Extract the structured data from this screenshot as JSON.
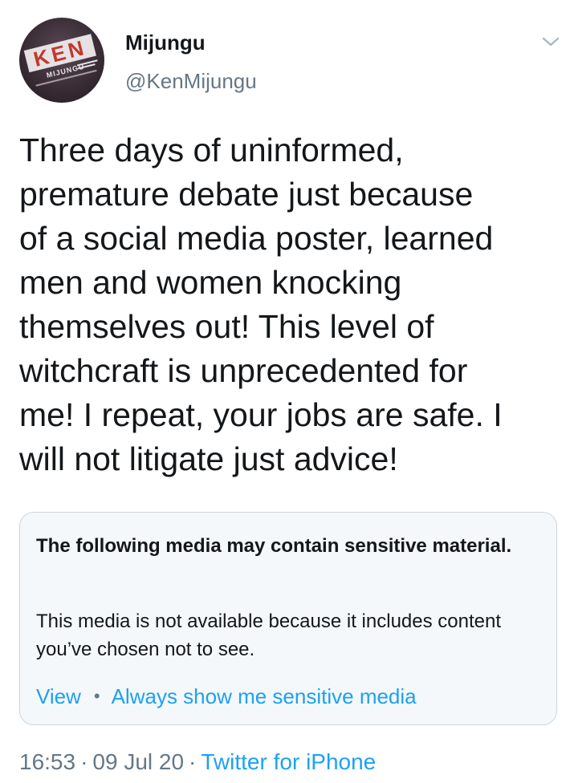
{
  "author": {
    "display_name": "Mijungu",
    "handle": "@KenMijungu",
    "avatar_logo_text": "KEN",
    "avatar_sub_text": "MIJUNGU"
  },
  "tweet": {
    "text_lines": [
      "Three days of uninformed,",
      "premature debate just because",
      "of a social media poster, learned",
      "men and women knocking",
      "themselves out! This level of",
      "witchcraft is unprecedented for",
      "me! I repeat, your jobs are safe. I",
      "will not litigate just advice!"
    ]
  },
  "sensitive_media": {
    "title": "The following media may contain sensitive material.",
    "body": "This media is not available because it includes content you’ve chosen not to see.",
    "view_label": "View",
    "separator": "•",
    "always_show_label": "Always show me sensitive media"
  },
  "meta": {
    "time": "16:53",
    "separator": "·",
    "date": "09 Jul 20",
    "source": "Twitter for iPhone"
  },
  "icons": {
    "menu": "chevron-down-icon"
  },
  "colors": {
    "link_blue": "#1da1f2",
    "secondary_text": "#657786",
    "primary_text": "#14171a",
    "card_border": "#ccd6dd",
    "card_background": "#f5f8fa"
  }
}
